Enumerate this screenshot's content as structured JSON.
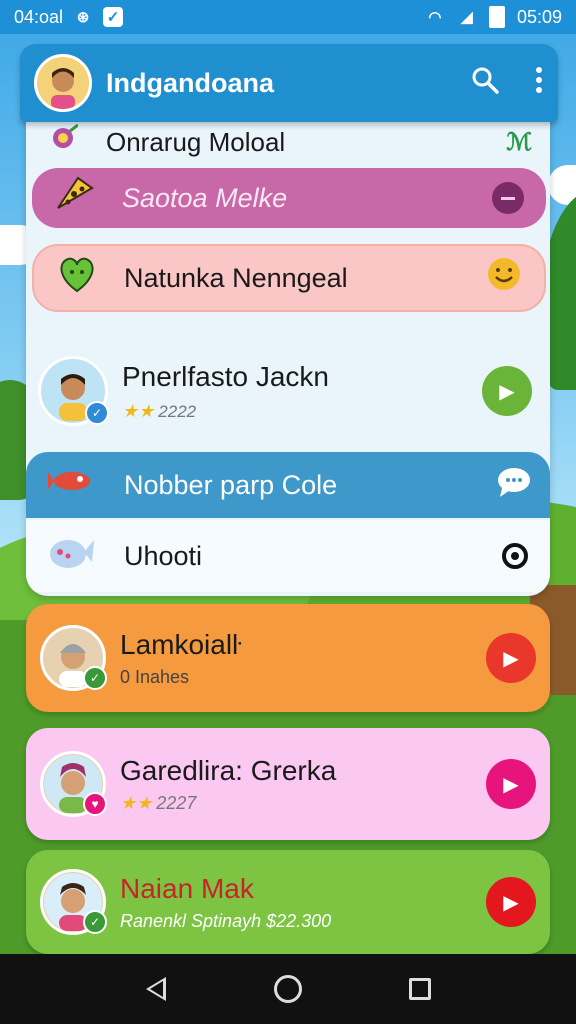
{
  "status_bar": {
    "time_left": "04:oal",
    "time_right": "05:09",
    "icons": [
      "notification-icon",
      "messenger-icon",
      "wifi-icon",
      "signal-icon",
      "battery-icon"
    ]
  },
  "app_bar": {
    "title": "Indgandoana",
    "avatar": "user-avatar",
    "actions": [
      "search-icon",
      "more-vert-icon"
    ],
    "color": "#1f8fd0"
  },
  "list": {
    "items": [
      {
        "label": "Onrarug Moloal",
        "icon": "flower-icon",
        "trailing": "ℳ"
      },
      {
        "label": "Saotoa Melke",
        "icon": "cheese-icon",
        "trailing_icon": "minus-circle-icon",
        "color": "#c868a8"
      },
      {
        "label": "Natunka Nenngeal",
        "icon": "heart-icon",
        "trailing_icon": "smile-icon",
        "color": "#fbc6c6"
      },
      {
        "label": "Pnerlfasto Jackn",
        "meta": "2222",
        "icon": "avatar",
        "trailing_icon": "play-icon",
        "color": "#6bb43a"
      },
      {
        "label": "Nobber parp Cole",
        "icon": "rocket-icon",
        "trailing_icon": "chat-bubble-icon",
        "color": "#3e98c9"
      },
      {
        "label": "Uhooti",
        "icon": "fish-icon",
        "trailing_icon": "target-icon"
      }
    ]
  },
  "cards": [
    {
      "title": "Lamkoialŀ",
      "subtitle": "0 Inahes",
      "color": "#f59a3e",
      "play_color": "#e9372b"
    },
    {
      "title": "Garedlira: Grerka",
      "subtitle": "2227",
      "color": "#fbc8f2",
      "play_color": "#e8147e"
    },
    {
      "title": "Naian Mak",
      "subtitle": "Ranenkl Sptinayh $22.300",
      "color": "#7cc441",
      "play_color": "#e4161e"
    }
  ],
  "nav": {
    "buttons": [
      "back-icon",
      "home-icon",
      "recents-icon"
    ]
  }
}
